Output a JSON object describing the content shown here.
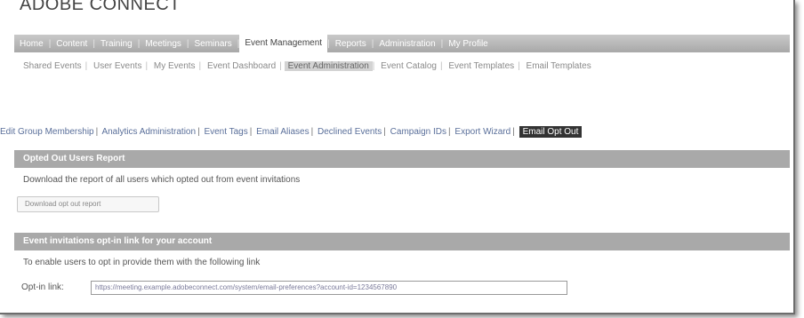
{
  "app": {
    "brand": "ADOBE CONNECT"
  },
  "topnav": {
    "items": [
      {
        "label": "Home"
      },
      {
        "label": "Content"
      },
      {
        "label": "Training"
      },
      {
        "label": "Meetings"
      },
      {
        "label": "Seminars"
      },
      {
        "label": "Event Management"
      },
      {
        "label": "Reports"
      },
      {
        "label": "Administration"
      },
      {
        "label": "My Profile"
      }
    ],
    "active_index": 5
  },
  "subnav": {
    "items": [
      {
        "label": "Shared Events"
      },
      {
        "label": "User Events"
      },
      {
        "label": "My Events"
      },
      {
        "label": "Event Dashboard"
      },
      {
        "label": "Event Administration"
      },
      {
        "label": "Event Catalog"
      },
      {
        "label": "Event Templates"
      },
      {
        "label": "Email Templates"
      }
    ],
    "active_index": 4
  },
  "linkbar": {
    "items": [
      {
        "label": "Edit Group Membership"
      },
      {
        "label": "Analytics Administration"
      },
      {
        "label": "Event Tags"
      },
      {
        "label": "Email Aliases"
      },
      {
        "label": "Declined Events"
      },
      {
        "label": "Campaign IDs"
      },
      {
        "label": "Export Wizard"
      },
      {
        "label": "Email Opt Out"
      }
    ],
    "active_index": 7
  },
  "opted_out_panel": {
    "title": "Opted Out Users Report",
    "description": "Download the report of all users which opted out from event invitations",
    "button_label": "Download opt out report"
  },
  "optin_panel": {
    "title": "Event invitations opt-in link for your account",
    "description": "To enable users to opt in provide them with the following link",
    "optin_label": "Opt-in link:",
    "optin_value": "https://meeting.example.adobeconnect.com/system/email-preferences?account-id=1234567890"
  }
}
